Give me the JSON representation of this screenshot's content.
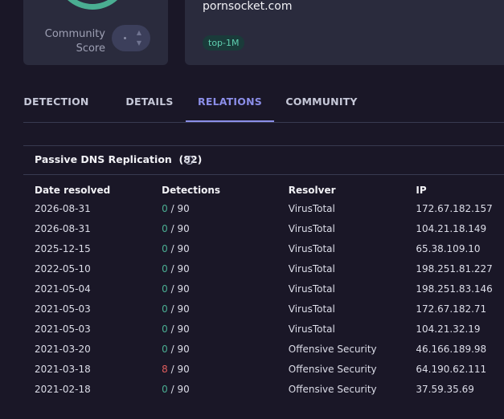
{
  "summary": {
    "community_label_1": "Community",
    "community_label_2": "Score",
    "domain": "pornsocket.com",
    "tag": "top-1M"
  },
  "tabs": [
    {
      "label": "DETECTION"
    },
    {
      "label": "DETAILS"
    },
    {
      "label": "RELATIONS",
      "active": true
    },
    {
      "label": "COMMUNITY"
    }
  ],
  "passive_dns": {
    "title": "Passive DNS Replication",
    "count": "(82)",
    "columns": [
      "Date resolved",
      "Detections",
      "Resolver",
      "IP"
    ],
    "rows": [
      {
        "date": "2026-08-31",
        "detected": "0",
        "total": "/ 90",
        "resolver": "VirusTotal",
        "ip": "172.67.182.157"
      },
      {
        "date": "2026-08-31",
        "detected": "0",
        "total": "/ 90",
        "resolver": "VirusTotal",
        "ip": "104.21.18.149"
      },
      {
        "date": "2025-12-15",
        "detected": "0",
        "total": "/ 90",
        "resolver": "VirusTotal",
        "ip": "65.38.109.10"
      },
      {
        "date": "2022-05-10",
        "detected": "0",
        "total": "/ 90",
        "resolver": "VirusTotal",
        "ip": "198.251.81.227"
      },
      {
        "date": "2021-05-04",
        "detected": "0",
        "total": "/ 90",
        "resolver": "VirusTotal",
        "ip": "198.251.83.146"
      },
      {
        "date": "2021-05-03",
        "detected": "0",
        "total": "/ 90",
        "resolver": "VirusTotal",
        "ip": "172.67.182.71"
      },
      {
        "date": "2021-05-03",
        "detected": "0",
        "total": "/ 90",
        "resolver": "VirusTotal",
        "ip": "104.21.32.19"
      },
      {
        "date": "2021-03-20",
        "detected": "0",
        "total": "/ 90",
        "resolver": "Offensive Security",
        "ip": "46.166.189.98"
      },
      {
        "date": "2021-03-18",
        "detected": "8",
        "total": "/ 90",
        "resolver": "Offensive Security",
        "ip": "64.190.62.111"
      },
      {
        "date": "2021-02-18",
        "detected": "0",
        "total": "/ 90",
        "resolver": "Offensive Security",
        "ip": "37.59.35.69"
      }
    ]
  },
  "colors": {
    "clean": "#4aae92",
    "malicious": "#e05d5d",
    "accent": "#8b8ee8"
  }
}
